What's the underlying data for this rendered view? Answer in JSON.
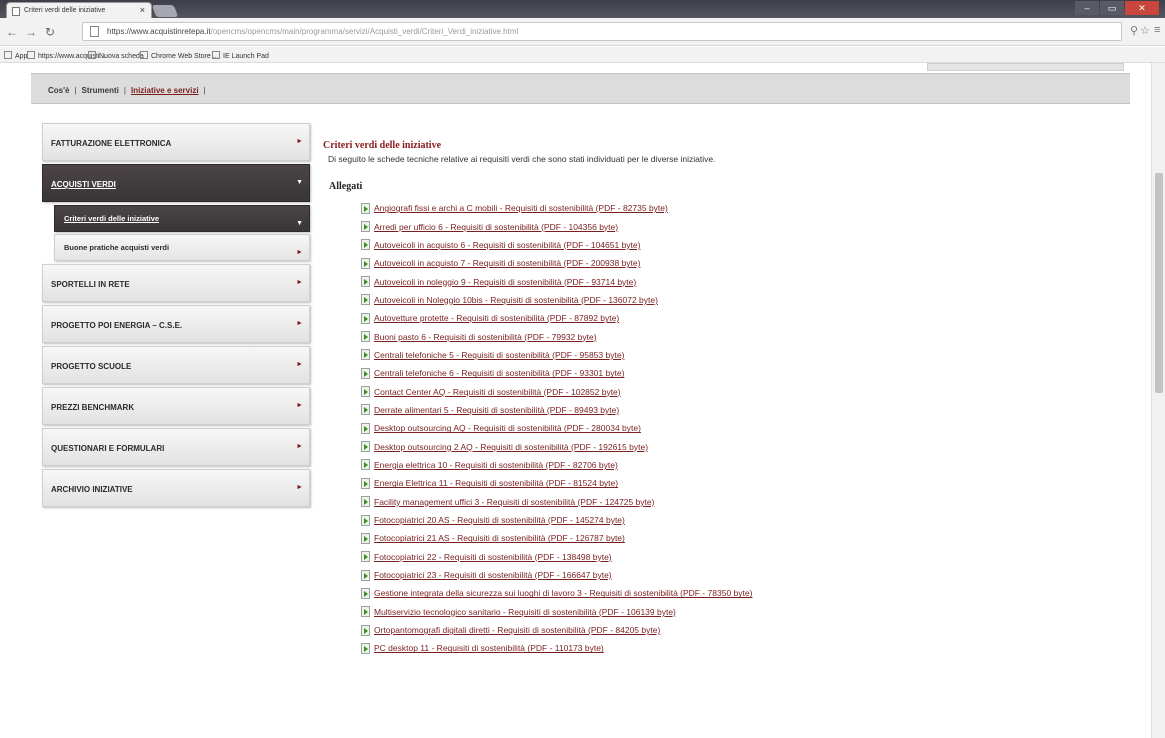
{
  "browser": {
    "tab_title": "Criteri verdi delle iniziative",
    "tab_close": "×",
    "url_host": "https://www.acquistinretepa.it",
    "url_path": "/opencms/opencms/main/programma/servizi/Acquisti_verdi/Criteri_Verdi_iniziative.html",
    "bookmarks": [
      {
        "label": "App"
      },
      {
        "label": "https://www.acquisti..."
      },
      {
        "label": "Nuova scheda"
      },
      {
        "label": "Chrome Web Store ..."
      },
      {
        "label": "IE Launch Pad"
      }
    ]
  },
  "breadcrumb": {
    "items": [
      "Cos'è",
      "Strumenti",
      "Iniziative e servizi"
    ],
    "separator": "|"
  },
  "sidebar": {
    "items": [
      {
        "label": "FATTURAZIONE ELETTRONICA",
        "open": false
      },
      {
        "label": "ACQUISTI VERDI",
        "open": true,
        "children": [
          {
            "label": "Criteri verdi delle iniziative",
            "active": true
          },
          {
            "label": "Buone pratiche acquisti verdi",
            "active": false
          }
        ]
      },
      {
        "label": "SPORTELLI IN RETE",
        "open": false
      },
      {
        "label": "PROGETTO POI ENERGIA – C.S.E.",
        "open": false
      },
      {
        "label": "PROGETTO SCUOLE",
        "open": false
      },
      {
        "label": "PREZZI BENCHMARK",
        "open": false
      },
      {
        "label": "QUESTIONARI E FORMULARI",
        "open": false
      },
      {
        "label": "ARCHIVIO INIZIATIVE",
        "open": false
      }
    ]
  },
  "content": {
    "title": "Criteri verdi delle iniziative",
    "intro": "Di seguito le schede tecniche relative ai requisiti verdi che sono stati individuati per le diverse iniziative.",
    "attachments_heading": "Allegati",
    "attachments": [
      "Angiografi fissi e archi a C mobili - Requisiti di sostenibilità (PDF - 82735 byte)",
      "Arredi per ufficio 6 - Requisiti di sostenibilità (PDF - 104356 byte)",
      "Autoveicoli in acquisto 6 - Requisiti di sostenibilità (PDF - 104651 byte)",
      "Autoveicoli in acquisto 7 - Requisiti di sostenibilità (PDF - 200938 byte)",
      "Autoveicoli in noleggio 9 - Requisiti di sostenibilità (PDF - 93714 byte)",
      "Autoveicoli in Noleggio 10bis - Requisiti di sostenibilità (PDF - 136072 byte)",
      "Autovetture protette - Requisiti di sostenibilità (PDF - 87892 byte)",
      "Buoni pasto 6 - Requisiti di sostenibilità (PDF - 79932 byte)",
      "Centrali telefoniche 5 - Requisiti di sostenibilità (PDF - 95853 byte)",
      "Centrali telefoniche 6 - Requisiti di sostenibilità (PDF - 93301 byte)",
      "Contact Center AQ - Requisiti di sostenibilità (PDF - 102852 byte)",
      "Derrate alimentari 5 - Requisiti di sostenibilità (PDF - 89493 byte)",
      "Desktop outsourcing AQ - Requisiti di sostenibilità (PDF - 280034 byte)",
      "Desktop outsourcing 2 AQ - Requisiti di sostenibilità (PDF - 192615 byte)",
      "Energia elettrica 10 - Requisiti di sostenibilità (PDF - 82706 byte)",
      "Energia Elettrica 11 - Requisiti di sostenibilità (PDF - 81524 byte)",
      "Facility management uffici 3 - Requisiti di sostenibilità (PDF - 124725 byte)",
      "Fotocopiatrici 20 AS - Requisiti di sostenibilità (PDF - 145274 byte)",
      "Fotocopiatrici 21 AS - Requisiti di sostenibilità (PDF - 126787 byte)",
      "Fotocopiatrici 22 - Requisiti di sostenibilità (PDF - 138498 byte)",
      "Fotocopiatrici 23 - Requisiti di sostenibilità (PDF - 166647 byte)",
      "Gestione integrata della sicurezza sui luoghi di lavoro 3 - Requisiti di sostenibilità (PDF - 78350 byte)",
      "Multiservizio tecnologico sanitario - Requisiti di sostenibilità (PDF - 106139 byte)",
      "Ortopantomografi digitali diretti - Requisiti di sostenibilità (PDF - 84205 byte)",
      "PC desktop 11 - Requisiti di sostenibilità (PDF - 110173 byte)"
    ]
  },
  "colors": {
    "link": "#7a1f1f",
    "title": "#8b1a1a",
    "menu_active_bg": "#3f3a3b"
  }
}
